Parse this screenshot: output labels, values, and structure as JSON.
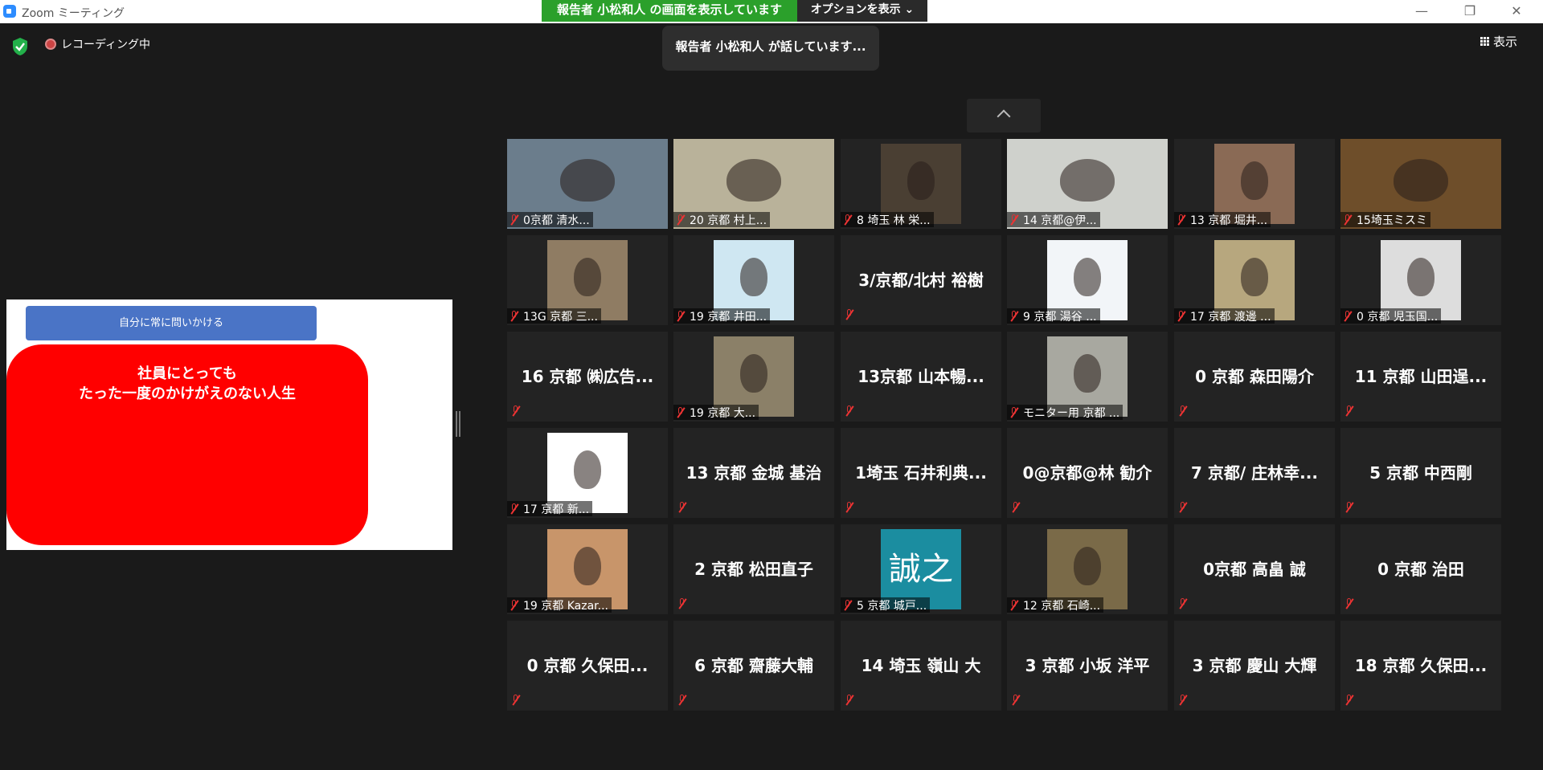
{
  "window": {
    "title": "Zoom ミーティング"
  },
  "share": {
    "banner": "報告者 小松和人 の画面を表示しています",
    "options": "オプションを表示 ⌄"
  },
  "controls": {
    "minimize": "—",
    "restore": "❐",
    "close": "✕"
  },
  "recording": {
    "label": "レコーディング中"
  },
  "view": {
    "label": "表示"
  },
  "toast": {
    "speaking": "報告者 小松和人 が話しています..."
  },
  "slide": {
    "button": "自分に常に問いかける",
    "line1": "社員にとっても",
    "line2": "たった一度のかけがえのない人生"
  },
  "colors": {
    "banner": "#2ba02b",
    "slide_button": "#4a74c6",
    "slide_red": "#ff0000",
    "muted": "#e33333"
  },
  "participants": [
    {
      "caption": "0京都 清水...",
      "photo": "#6b7d8c"
    },
    {
      "caption": "20 京都 村上...",
      "photo": "#b9b29a"
    },
    {
      "caption": "8 埼玉 林 栄...",
      "photo": "#4a3f33"
    },
    {
      "caption": "14 京都@伊...",
      "photo": "#cfd1cc"
    },
    {
      "caption": "13 京都 堀井...",
      "photo": "#8a6a55"
    },
    {
      "caption": "15埼玉ミスミ",
      "photo": "#6e4e2a"
    },
    {
      "caption": "13G 京都 三...",
      "photo": "#8f7c63"
    },
    {
      "caption": "19 京都 井田...",
      "photo": "#cfe7f2"
    },
    {
      "name": "3/京都/北村 裕樹"
    },
    {
      "caption": "9 京都 湯谷 ...",
      "photo": "#f2f5f8"
    },
    {
      "caption": "17 京都 渡邊 ...",
      "photo": "#b7a77e"
    },
    {
      "caption": "0 京都 児玉国...",
      "photo": "#dddddd"
    },
    {
      "name": "16 京都 ㈱広告..."
    },
    {
      "caption": "19 京都 大...",
      "photo": "#8b8068"
    },
    {
      "name": "13京都 山本暢..."
    },
    {
      "caption": "モニター用 京都 ...",
      "photo": "#a8a8a0"
    },
    {
      "name": "0 京都 森田陽介"
    },
    {
      "name": "11 京都 山田逞..."
    },
    {
      "caption": "17 京都 新...",
      "photo": "#ffffff"
    },
    {
      "name": "13 京都 金城 基治"
    },
    {
      "name": "1埼玉 石井利典..."
    },
    {
      "name": "0@京都@林 勧介"
    },
    {
      "name": "7 京都/ 庄林幸..."
    },
    {
      "name": "5 京都 中西剛"
    },
    {
      "caption": "19 京都 Kazar...",
      "photo": "#c8956a"
    },
    {
      "name": "2 京都 松田直子"
    },
    {
      "caption": "5 京都 城戸...",
      "photo": "#1b8da0",
      "photo_text": "誠之"
    },
    {
      "caption": "12 京都 石崎...",
      "photo": "#7a6a48"
    },
    {
      "name": "0京都 高畠 誠"
    },
    {
      "name": "0 京都 治田"
    },
    {
      "name": "0 京都 久保田..."
    },
    {
      "name": "6 京都 齋藤大輔"
    },
    {
      "name": "14 埼玉 嶺山 大"
    },
    {
      "name": "3 京都 小坂 洋平"
    },
    {
      "name": "3 京都 慶山 大輝"
    },
    {
      "name": "18 京都 久保田..."
    }
  ]
}
